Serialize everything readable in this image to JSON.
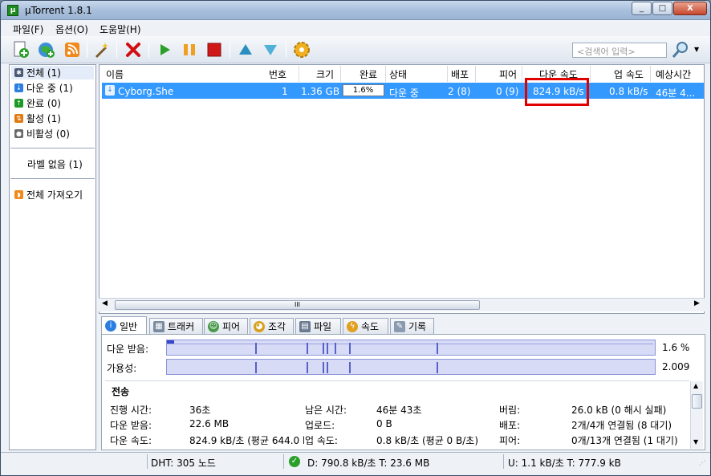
{
  "window": {
    "title": "µTorrent 1.8.1",
    "app_icon": "µ",
    "minimize_icon": "_",
    "maximize_icon": "□",
    "close_icon": "X"
  },
  "menu": [
    "파일(F)",
    "옵션(O)",
    "도움말(H)"
  ],
  "toolbar": {
    "buttons": [
      "add-torrent-icon",
      "add-url-icon",
      "rss-icon",
      "create-torrent-icon",
      "remove-icon",
      "start-icon",
      "pause-icon",
      "stop-icon",
      "move-up-icon",
      "move-down-icon",
      "preferences-icon"
    ],
    "search_placeholder": "<검색어 입력>",
    "search_icon": "search-icon"
  },
  "sidebar": {
    "items": [
      {
        "label": "전체 (1)",
        "icon": "all-icon",
        "color": "#4a5a72"
      },
      {
        "label": "다운 중 (1)",
        "icon": "downloading-icon",
        "color": "#2a7fe0"
      },
      {
        "label": "완료 (0)",
        "icon": "completed-icon",
        "color": "#1d9a26"
      },
      {
        "label": "활성 (1)",
        "icon": "active-icon",
        "color": "#e07a10"
      },
      {
        "label": "비활성 (0)",
        "icon": "inactive-icon",
        "color": "#6a6a6a"
      }
    ],
    "label_none": "라벨 없음 (1)",
    "feeds": "전체 가져오기"
  },
  "columns": [
    "이름",
    "번호",
    "크기",
    "완료",
    "상태",
    "배포",
    "피어",
    "다운 속도",
    "업 속도",
    "예상시간"
  ],
  "torrent": {
    "name": "Cyborg.She",
    "number": "1",
    "size": "1.36 GB",
    "done": "1.6%",
    "done_fraction": 0.016,
    "status": "다운 중",
    "seeds": "2 (8)",
    "peers": "0 (9)",
    "down_speed": "824.9 kB/s",
    "up_speed": "0.8 kB/s",
    "eta": "46분 4..."
  },
  "hscroll_grip": "III",
  "tabs": [
    {
      "label": "일반",
      "icon": "info-icon"
    },
    {
      "label": "트래커",
      "icon": "tracker-icon"
    },
    {
      "label": "피어",
      "icon": "peers-icon"
    },
    {
      "label": "조각",
      "icon": "pieces-icon"
    },
    {
      "label": "파일",
      "icon": "files-icon"
    },
    {
      "label": "속도",
      "icon": "speed-icon"
    },
    {
      "label": "기록",
      "icon": "log-icon"
    }
  ],
  "general": {
    "downloaded_label": "다운 받음:",
    "downloaded_value": "1.6 %",
    "availability_label": "가용성:",
    "availability_value": "2.009",
    "transfer_title": "전송",
    "fields": [
      {
        "k": "진행 시간:",
        "v": "36초"
      },
      {
        "k": "남은 시간:",
        "v": "46분 43초"
      },
      {
        "k": "버림:",
        "v": "26.0 kB (0 해시 실패)"
      },
      {
        "k": "다운 받음:",
        "v": "22.6 MB"
      },
      {
        "k": "업로드:",
        "v": "0 B"
      },
      {
        "k": "배포:",
        "v": "2개/4개 연결됨 (8 대기)"
      },
      {
        "k": "다운 속도:",
        "v": "824.9 kB/초 (평균 644.0 k"
      },
      {
        "k": "업 속도:",
        "v": "0.8 kB/초 (평균 0 B/초)"
      },
      {
        "k": "피어:",
        "v": "0개/13개 연결됨 (1 대기)"
      }
    ]
  },
  "statusbar": {
    "dht": "DHT: 305 노드",
    "download": "D: 790.8 kB/초 T: 23.6 MB",
    "upload": "U: 1.1 kB/초 T: 777.9 kB"
  }
}
